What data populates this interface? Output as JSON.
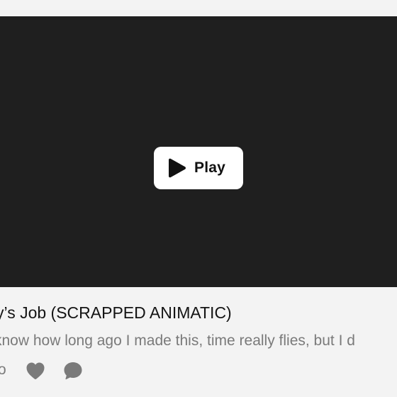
{
  "video": {
    "play_label": "Play",
    "play_icon": "play-icon"
  },
  "post": {
    "title": "y’s Job (SCRAPPED ANIMATIC)",
    "description": "know how long ago I made this, time really flies, but I d",
    "meta_count": "o",
    "like_icon": "heart-icon",
    "comment_icon": "comment-bubble-icon"
  },
  "colors": {
    "page_bg": "#f3f3f3",
    "video_bg": "#1f1f1f",
    "button_bg": "#ffffff",
    "text_primary": "#141414",
    "text_secondary": "#7a7a7a"
  }
}
